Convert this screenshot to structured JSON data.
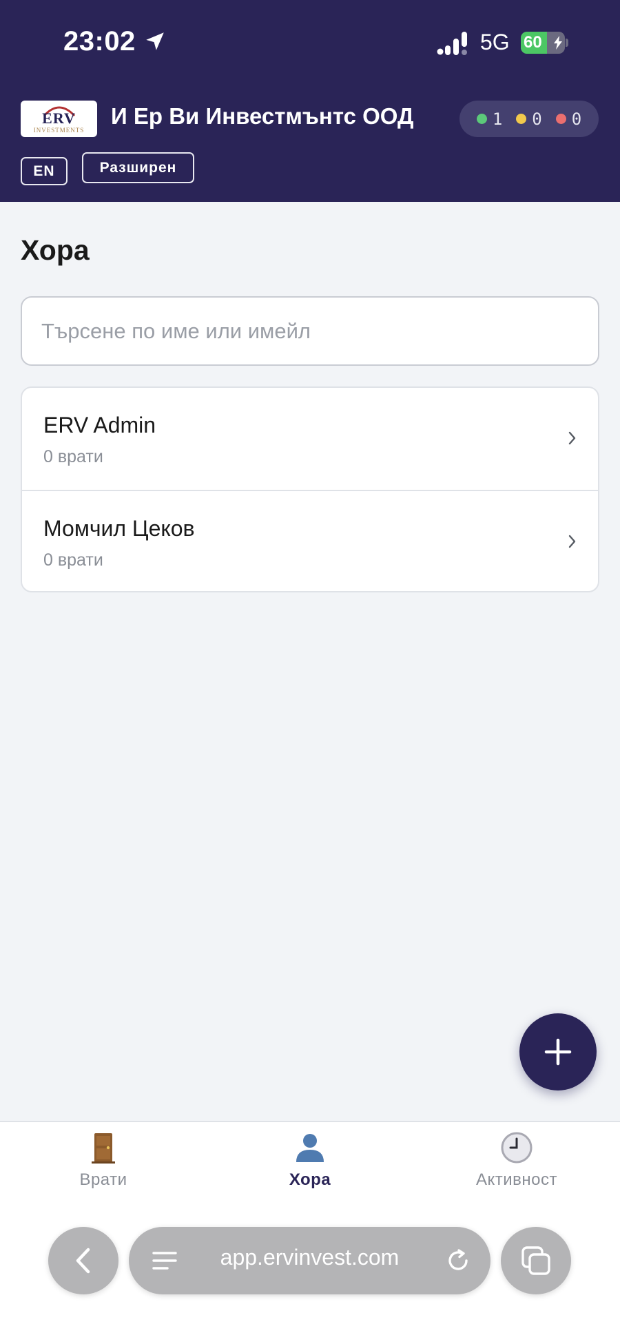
{
  "status_bar": {
    "time": "23:02",
    "network": "5G",
    "battery_level": "60",
    "battery_fraction": 0.6
  },
  "header": {
    "logo": {
      "main": "ERV",
      "sub": "INVESTMENTS"
    },
    "company_name": "И Ер Ви Инвестмънтс ООД",
    "counters": [
      {
        "value": "1",
        "color": "#5cc97a"
      },
      {
        "value": "0",
        "color": "#f2c94c"
      },
      {
        "value": "0",
        "color": "#eb6f6f"
      }
    ],
    "language_button": "EN",
    "mode_button": "Разширен"
  },
  "main": {
    "title": "Хора",
    "search": {
      "placeholder": "Търсене по име или имейл",
      "value": ""
    },
    "people": [
      {
        "name": "ERV Admin",
        "doors": "0 врати"
      },
      {
        "name": "Момчил Цеков",
        "doors": "0 врати"
      }
    ],
    "fab_icon": "plus-icon"
  },
  "tabbar": {
    "tabs": [
      {
        "label": "Врати",
        "icon": "door-icon",
        "active": false
      },
      {
        "label": "Хора",
        "icon": "person-icon",
        "active": true
      },
      {
        "label": "Активност",
        "icon": "clock-icon",
        "active": false
      }
    ]
  },
  "browser": {
    "url": "app.ervinvest.com"
  },
  "colors": {
    "header_bg": "#2a2457",
    "accent": "#2a2457",
    "page_bg": "#f2f4f7"
  }
}
